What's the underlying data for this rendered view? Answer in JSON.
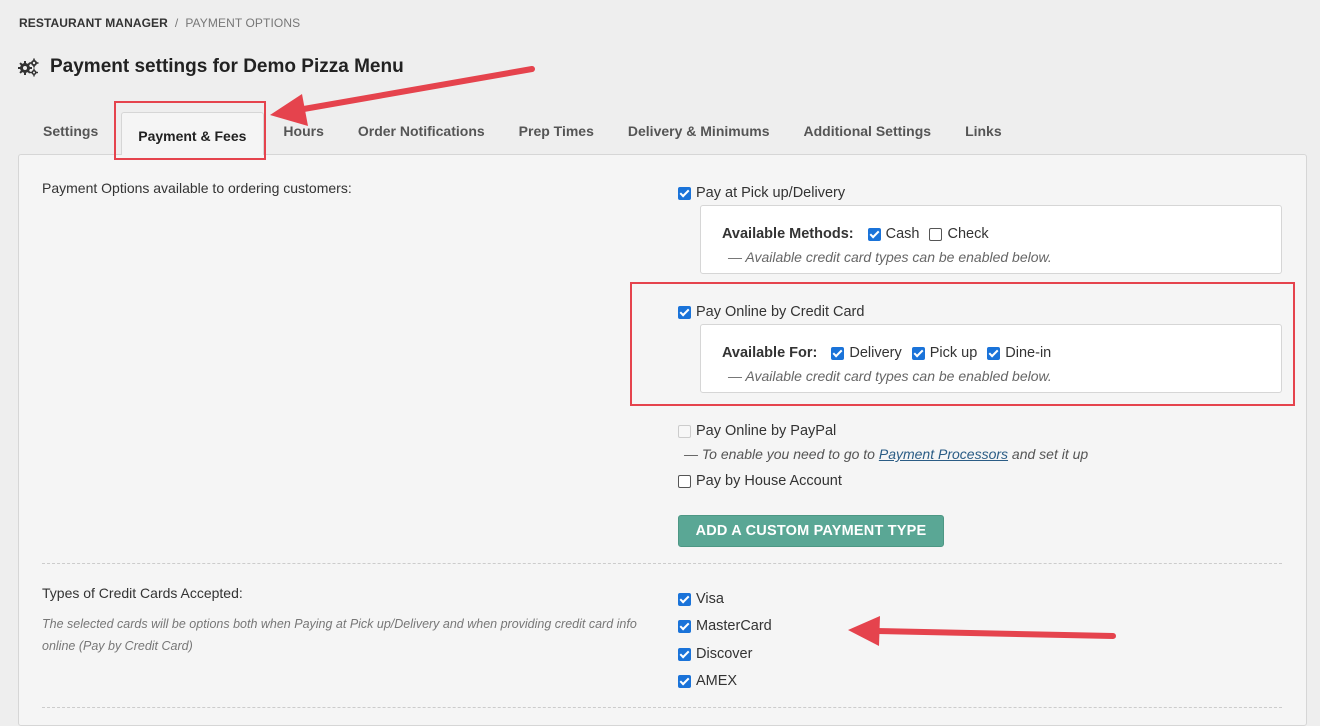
{
  "breadcrumb": {
    "home": "RESTAURANT MANAGER",
    "separator": "/",
    "current": "PAYMENT OPTIONS"
  },
  "page": {
    "title": "Payment settings for Demo Pizza Menu",
    "title_icon": "gears-icon"
  },
  "tabs": [
    {
      "label": "Settings",
      "active": false
    },
    {
      "label": "Payment & Fees",
      "active": true
    },
    {
      "label": "Hours",
      "active": false
    },
    {
      "label": "Order Notifications",
      "active": false
    },
    {
      "label": "Prep Times",
      "active": false
    },
    {
      "label": "Delivery & Minimums",
      "active": false
    },
    {
      "label": "Additional Settings",
      "active": false
    },
    {
      "label": "Links",
      "active": false
    }
  ],
  "payment_options": {
    "section_label": "Payment Options available to ordering customers:",
    "pickup_delivery": {
      "label": "Pay at Pick up/Delivery",
      "checked": true,
      "methods_label": "Available Methods:",
      "methods": [
        {
          "label": "Cash",
          "checked": true
        },
        {
          "label": "Check",
          "checked": false
        }
      ],
      "note": "— Available credit card types can be enabled below."
    },
    "credit_card": {
      "label": "Pay Online by Credit Card",
      "checked": true,
      "available_for_label": "Available For:",
      "available_for": [
        {
          "label": "Delivery",
          "checked": true
        },
        {
          "label": "Pick up",
          "checked": true
        },
        {
          "label": "Dine-in",
          "checked": true
        }
      ],
      "note": "— Available credit card types can be enabled below."
    },
    "paypal": {
      "label": "Pay Online by PayPal",
      "checked": false,
      "disabled": true,
      "note_prefix": "— To enable you need to go to",
      "note_link": "Payment Processors",
      "note_suffix": "and set it up"
    },
    "house_account": {
      "label": "Pay by House Account",
      "checked": false
    },
    "add_custom_button": "ADD A CUSTOM PAYMENT TYPE"
  },
  "credit_cards": {
    "section_label": "Types of Credit Cards Accepted:",
    "help": "The selected cards will be options both when Paying at Pick up/Delivery and when providing credit card info online (Pay by Credit Card)",
    "cards": [
      {
        "label": "Visa",
        "checked": true
      },
      {
        "label": "MasterCard",
        "checked": true
      },
      {
        "label": "Discover",
        "checked": true
      },
      {
        "label": "AMEX",
        "checked": true
      }
    ]
  },
  "annotation_color": "#e5434d",
  "button_color": "#5aa795",
  "checkbox_color": "#1a73d9"
}
